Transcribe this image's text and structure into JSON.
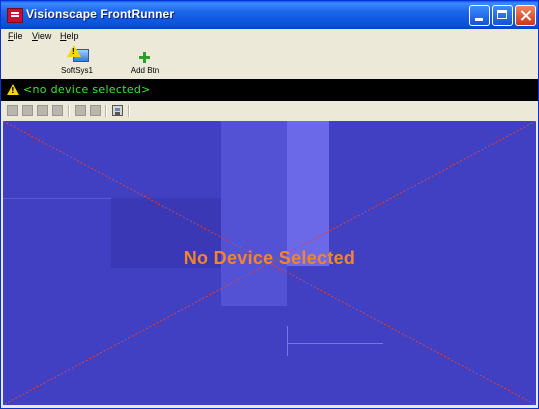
{
  "window": {
    "title": "Visionscape FrontRunner"
  },
  "menu": {
    "items": [
      "File",
      "View",
      "Help"
    ]
  },
  "toolbar": {
    "softsys_label": "SoftSys1",
    "add_btn_label": "Add Btn"
  },
  "status": {
    "text": "<no device selected>"
  },
  "viewport": {
    "message": "No Device Selected"
  },
  "colors": {
    "titlebar": "#0a4fd8",
    "status_bg": "#000000",
    "status_text": "#3ce63c",
    "viewport_bg": "#4240c2",
    "message": "#f5842c",
    "crosshair": "#d84040"
  }
}
